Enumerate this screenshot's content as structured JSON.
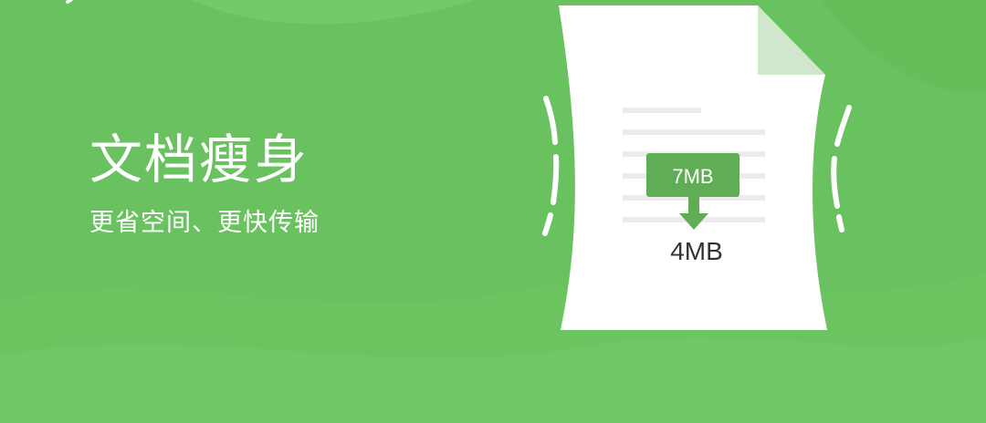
{
  "feature": {
    "title": "文档瘦身",
    "subtitle": "更省空间、更快传输"
  },
  "illustration": {
    "original_size": "7MB",
    "compressed_size": "4MB",
    "icons": [
      "back-chevron-icon",
      "document-icon",
      "down-arrow-icon",
      "squeeze-marks-icon"
    ]
  },
  "colors": {
    "background": "#69c25f",
    "wave_light": "#74c96a",
    "wave_dark": "#5fb955",
    "document": "#ffffff",
    "document_fold": "#cfe8cc",
    "badge": "#5fae55",
    "text_dark": "#333333",
    "doc_lines": "#ececec"
  }
}
